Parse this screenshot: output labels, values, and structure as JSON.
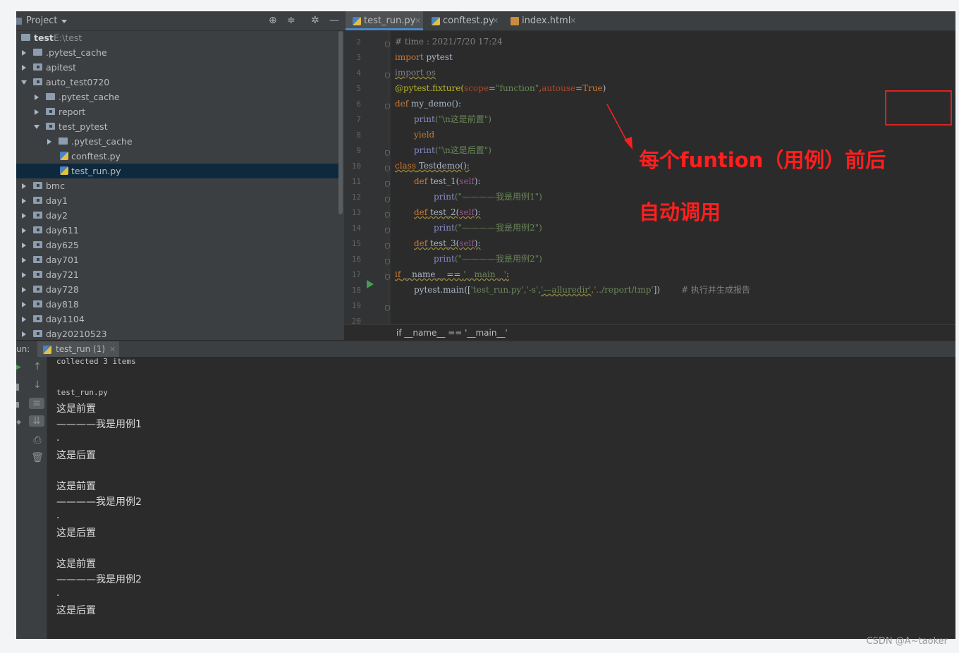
{
  "project_panel": {
    "title": "Project",
    "tree": [
      {
        "label": "test",
        "path": "E:\\test"
      },
      {
        "label": ".pytest_cache"
      },
      {
        "label": "apitest"
      },
      {
        "label": "auto_test0720"
      },
      {
        "label": ".pytest_cache"
      },
      {
        "label": "report"
      },
      {
        "label": "test_pytest"
      },
      {
        "label": ".pytest_cache"
      },
      {
        "label": "conftest.py"
      },
      {
        "label": "test_run.py"
      },
      {
        "label": "bmc"
      },
      {
        "label": "day1"
      },
      {
        "label": "day2"
      },
      {
        "label": "day611"
      },
      {
        "label": "day625"
      },
      {
        "label": "day701"
      },
      {
        "label": "day721"
      },
      {
        "label": "day728"
      },
      {
        "label": "day818"
      },
      {
        "label": "day1104"
      },
      {
        "label": "day20210523"
      }
    ]
  },
  "editor_tabs": [
    {
      "label": "test_run.py",
      "active": true
    },
    {
      "label": "conftest.py",
      "active": false
    },
    {
      "label": "index.html",
      "active": false
    }
  ],
  "code": {
    "line_numbers": [
      "2",
      "3",
      "4",
      "5",
      "6",
      "7",
      "8",
      "9",
      "10",
      "11",
      "12",
      "13",
      "14",
      "15",
      "16",
      "17",
      "18",
      "19",
      "20"
    ],
    "l2": "# time : 2021/7/20 17:24",
    "l3_kw": "import",
    "l3_rest": " pytest",
    "l4": "import os",
    "l5_dec": "@pytest.fixture(",
    "l5_p1": "scope",
    "l5_eq1": "=",
    "l5_s1": "\"function\"",
    "l5_comma": ",",
    "l5_p2": "autouse",
    "l5_eq2": "=",
    "l5_v2": "True",
    "l5_end": ")",
    "l6_kw": "def",
    "l6_rest": " my_demo():",
    "l7_fn": "print",
    "l7_s": "(\"\\n这是前置\")",
    "l8_kw": "yield",
    "l9_fn": "print",
    "l9_s": "(\"\\n这是后置\")",
    "l10_kw": "class",
    "l10_rest": " Testdemo():",
    "l11_kw": "def",
    "l11_name": " test_1(",
    "l11_self": "self",
    "l11_end": "):",
    "l12_fn": "print",
    "l12_s": "(\"————我是用例1\")",
    "l13_kw": "def",
    "l13_name": " test_2(",
    "l13_self": "self",
    "l13_end": "):",
    "l14_fn": "print",
    "l14_s": "(\"————我是用例2\")",
    "l15_kw": "def",
    "l15_name": " test_3(",
    "l15_self": "self",
    "l15_end": "):",
    "l16_fn": "print",
    "l16_s": "(\"————我是用例2\")",
    "l17_kw": "if",
    "l17_rest": " __name__ == ",
    "l17_s": "'__main__'",
    "l17_end": ":",
    "l18_a": "pytest.main([",
    "l18_s1": "'test_run.py'",
    "l18_c1": ",",
    "l18_s2": "'-s'",
    "l18_c2": ",",
    "l18_s3": "'—alluredir'",
    "l18_c3": ",",
    "l18_s4": "'../report/tmp'",
    "l18_end": "])",
    "l18_cm": "# 执行并生成报告"
  },
  "breadcrumb": "if __name__ == '__main__'",
  "annotations": {
    "line1": "每个funtion（用例）前后",
    "line2": "自动调用",
    "color": "#ff1f1f"
  },
  "run_panel": {
    "label": "un:",
    "tab": "test_run (1)",
    "output": [
      "collected 3 items",
      "",
      "test_run.py",
      "这是前置",
      "————我是用例1",
      ".",
      "这是后置",
      "",
      "这是前置",
      "————我是用例2",
      ".",
      "这是后置",
      "",
      "这是前置",
      "————我是用例2",
      ".",
      "这是后置"
    ]
  },
  "watermark": "CSDN @A~taoker"
}
